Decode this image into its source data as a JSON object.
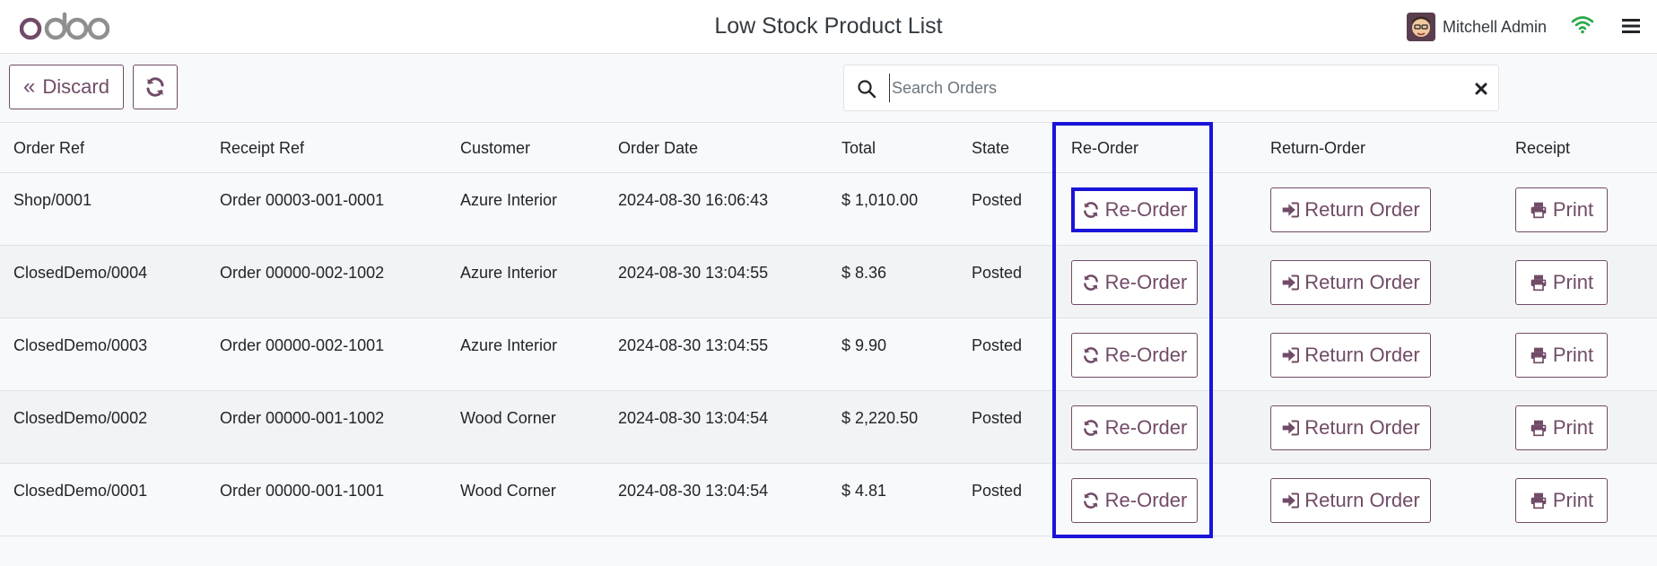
{
  "app": {
    "logo_text": "odoo",
    "page_title": "Low Stock Product List",
    "user_name": "Mitchell Admin",
    "accent_color": "#714b67",
    "highlight_color": "#1a14d9"
  },
  "toolbar": {
    "discard_label": "Discard",
    "discard_icon": "double-chevron-left-icon",
    "refresh_icon": "refresh-icon"
  },
  "search": {
    "placeholder": "Search Orders",
    "value": ""
  },
  "table": {
    "columns": [
      "Order Ref",
      "Receipt Ref",
      "Customer",
      "Order Date",
      "Total",
      "State",
      "Re-Order",
      "Return-Order",
      "Receipt"
    ],
    "actions": {
      "reorder_label": "Re-Order",
      "return_label": "Return Order",
      "print_label": "Print"
    },
    "rows": [
      {
        "order_ref": "Shop/0001",
        "receipt_ref": "Order 00003-001-0001",
        "customer": "Azure Interior",
        "order_date": "2024-08-30 16:06:43",
        "total": "$ 1,010.00",
        "state": "Posted"
      },
      {
        "order_ref": "ClosedDemo/0004",
        "receipt_ref": "Order 00000-002-1002",
        "customer": "Azure Interior",
        "order_date": "2024-08-30 13:04:55",
        "total": "$ 8.36",
        "state": "Posted"
      },
      {
        "order_ref": "ClosedDemo/0003",
        "receipt_ref": "Order 00000-002-1001",
        "customer": "Azure Interior",
        "order_date": "2024-08-30 13:04:55",
        "total": "$ 9.90",
        "state": "Posted"
      },
      {
        "order_ref": "ClosedDemo/0002",
        "receipt_ref": "Order 00000-001-1002",
        "customer": "Wood Corner",
        "order_date": "2024-08-30 13:04:54",
        "total": "$ 2,220.50",
        "state": "Posted"
      },
      {
        "order_ref": "ClosedDemo/0001",
        "receipt_ref": "Order 00000-001-1001",
        "customer": "Wood Corner",
        "order_date": "2024-08-30 13:04:54",
        "total": "$ 4.81",
        "state": "Posted"
      }
    ]
  }
}
